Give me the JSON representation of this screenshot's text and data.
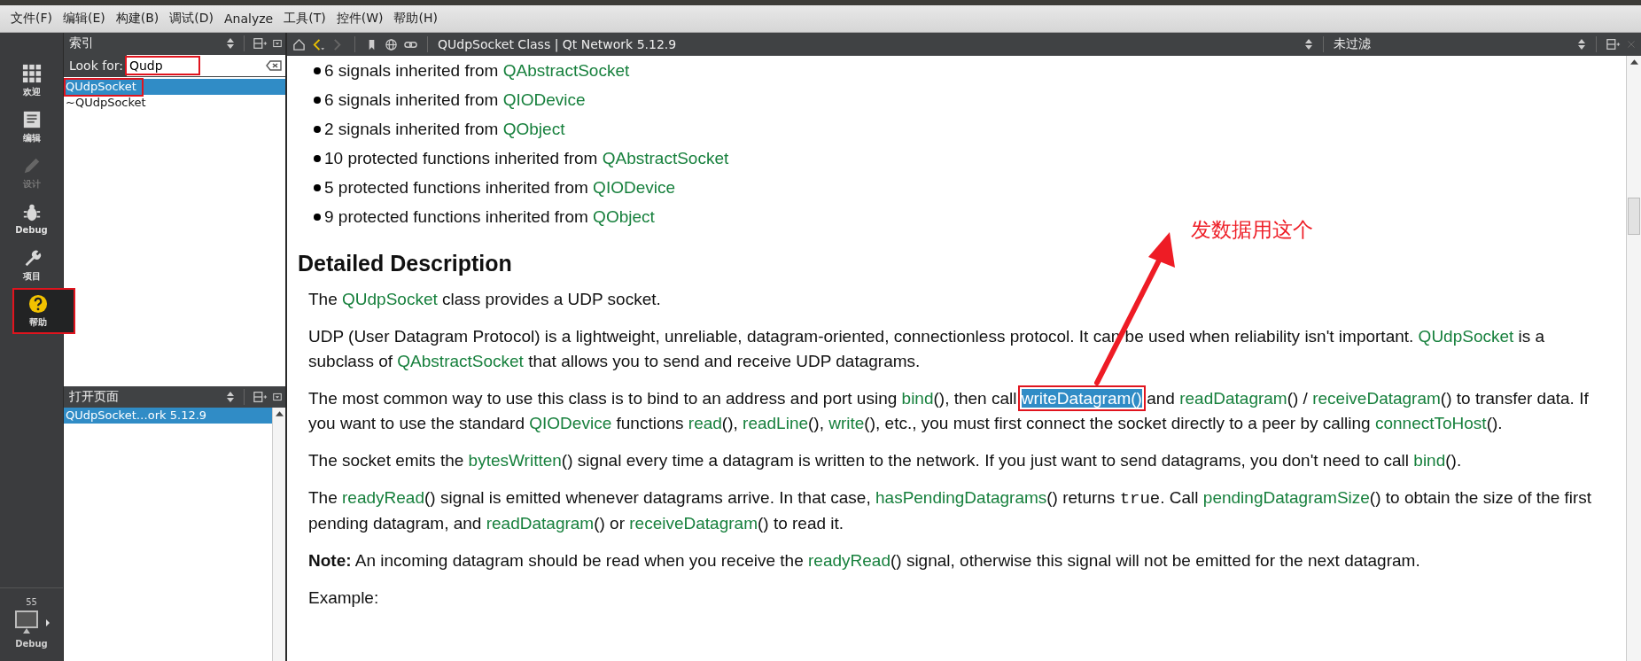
{
  "menu": [
    {
      "label": "文件(F)"
    },
    {
      "label": "编辑(E)"
    },
    {
      "label": "构建(B)"
    },
    {
      "label": "调试(D)"
    },
    {
      "label": "Analyze"
    },
    {
      "label": "工具(T)"
    },
    {
      "label": "控件(W)"
    },
    {
      "label": "帮助(H)"
    }
  ],
  "modes": [
    {
      "label": "欢迎",
      "kind": "grid",
      "selected": false,
      "disabled": false,
      "outlined": false
    },
    {
      "label": "编辑",
      "kind": "doc",
      "selected": false,
      "disabled": false,
      "outlined": false
    },
    {
      "label": "设计",
      "kind": "pencil",
      "selected": false,
      "disabled": true,
      "outlined": false
    },
    {
      "label": "Debug",
      "kind": "bug",
      "selected": false,
      "disabled": false,
      "outlined": false
    },
    {
      "label": "项目",
      "kind": "wrench",
      "selected": false,
      "disabled": false,
      "outlined": false
    },
    {
      "label": "帮助",
      "kind": "help",
      "selected": true,
      "disabled": false,
      "outlined": true
    }
  ],
  "target": {
    "count": "55",
    "label": "Debug"
  },
  "index_panel": {
    "title": "索引",
    "search_label": "Look for:",
    "search_value": "Qudp",
    "search_outlined": true,
    "results": [
      {
        "label": "QUdpSocket",
        "selected": true,
        "outlined": true
      },
      {
        "label": "~QUdpSocket",
        "selected": false,
        "outlined": false
      }
    ]
  },
  "open_pages": {
    "title": "打开页面",
    "items": [
      {
        "label": "QUdpSocket…ork 5.12.9",
        "selected": true
      }
    ]
  },
  "doc_toolbar": {
    "title": "QUdpSocket Class | Qt Network 5.12.9",
    "filter": "未过滤"
  },
  "doc": {
    "bullets": [
      [
        {
          "kind": "text",
          "text": "6 signals inherited from "
        },
        {
          "kind": "link",
          "text": "QAbstractSocket"
        }
      ],
      [
        {
          "kind": "text",
          "text": "6 signals inherited from "
        },
        {
          "kind": "link",
          "text": "QIODevice"
        }
      ],
      [
        {
          "kind": "text",
          "text": "2 signals inherited from "
        },
        {
          "kind": "link",
          "text": "QObject"
        }
      ],
      [
        {
          "kind": "text",
          "text": "10 protected functions inherited from "
        },
        {
          "kind": "link",
          "text": "QAbstractSocket"
        }
      ],
      [
        {
          "kind": "text",
          "text": "5 protected functions inherited from "
        },
        {
          "kind": "link",
          "text": "QIODevice"
        }
      ],
      [
        {
          "kind": "text",
          "text": "9 protected functions inherited from "
        },
        {
          "kind": "link",
          "text": "QObject"
        }
      ]
    ],
    "heading": "Detailed Description",
    "paragraphs": [
      [
        {
          "kind": "text",
          "text": "The "
        },
        {
          "kind": "link",
          "text": "QUdpSocket"
        },
        {
          "kind": "text",
          "text": " class provides a UDP socket."
        }
      ],
      [
        {
          "kind": "text",
          "text": "UDP (User Datagram Protocol) is a lightweight, unreliable, datagram-oriented, connectionless protocol. It can be used when reliability isn't important. "
        },
        {
          "kind": "link",
          "text": "QUdpSocket"
        },
        {
          "kind": "text",
          "text": " is a subclass of "
        },
        {
          "kind": "link",
          "text": "QAbstractSocket"
        },
        {
          "kind": "text",
          "text": " that allows you to send and receive UDP datagrams."
        }
      ],
      [
        {
          "kind": "text",
          "text": "The most common way to use this class is to bind to an address and port using "
        },
        {
          "kind": "link",
          "text": "bind"
        },
        {
          "kind": "text",
          "text": "(), then call "
        },
        {
          "kind": "selected-link",
          "text": "writeDatagram()"
        },
        {
          "kind": "text",
          "text": " and "
        },
        {
          "kind": "link",
          "text": "readDatagram"
        },
        {
          "kind": "text",
          "text": "() / "
        },
        {
          "kind": "link",
          "text": "receiveDatagram"
        },
        {
          "kind": "text",
          "text": "() to transfer data. If you want to use the standard "
        },
        {
          "kind": "link",
          "text": "QIODevice"
        },
        {
          "kind": "text",
          "text": " functions "
        },
        {
          "kind": "link",
          "text": "read"
        },
        {
          "kind": "text",
          "text": "(), "
        },
        {
          "kind": "link",
          "text": "readLine"
        },
        {
          "kind": "text",
          "text": "(), "
        },
        {
          "kind": "link",
          "text": "write"
        },
        {
          "kind": "text",
          "text": "(), etc., you must first connect the socket directly to a peer by calling "
        },
        {
          "kind": "link",
          "text": "connectToHost"
        },
        {
          "kind": "text",
          "text": "()."
        }
      ],
      [
        {
          "kind": "text",
          "text": "The socket emits the "
        },
        {
          "kind": "link",
          "text": "bytesWritten"
        },
        {
          "kind": "text",
          "text": "() signal every time a datagram is written to the network. If you just want to send datagrams, you don't need to call "
        },
        {
          "kind": "link",
          "text": "bind"
        },
        {
          "kind": "text",
          "text": "()."
        }
      ],
      [
        {
          "kind": "text",
          "text": "The "
        },
        {
          "kind": "link",
          "text": "readyRead"
        },
        {
          "kind": "text",
          "text": "() signal is emitted whenever datagrams arrive. In that case, "
        },
        {
          "kind": "link",
          "text": "hasPendingDatagrams"
        },
        {
          "kind": "text",
          "text": "() returns "
        },
        {
          "kind": "code",
          "text": "true"
        },
        {
          "kind": "text",
          "text": ". Call "
        },
        {
          "kind": "link",
          "text": "pendingDatagramSize"
        },
        {
          "kind": "text",
          "text": "() to obtain the size of the first pending datagram, and "
        },
        {
          "kind": "link",
          "text": "readDatagram"
        },
        {
          "kind": "text",
          "text": "() or "
        },
        {
          "kind": "link",
          "text": "receiveDatagram"
        },
        {
          "kind": "text",
          "text": "() to read it."
        }
      ],
      [
        {
          "kind": "bold",
          "text": "Note:"
        },
        {
          "kind": "text",
          "text": " An incoming datagram should be read when you receive the "
        },
        {
          "kind": "link",
          "text": "readyRead"
        },
        {
          "kind": "text",
          "text": "() signal, otherwise this signal will not be emitted for the next datagram."
        }
      ],
      [
        {
          "kind": "text",
          "text": "Example:"
        }
      ]
    ]
  },
  "annotation": {
    "note": "发数据用这个"
  }
}
